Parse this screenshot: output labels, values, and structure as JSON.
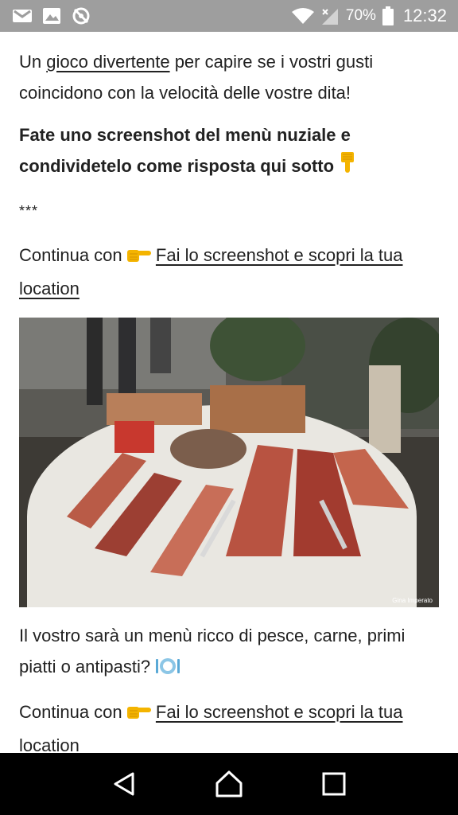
{
  "status_bar": {
    "battery_percent": "70%",
    "time": "12:32",
    "icons": [
      "gmail-icon",
      "image-icon",
      "settings-off-icon",
      "wifi-icon",
      "signal-icon",
      "battery-icon"
    ]
  },
  "article": {
    "p1_before": "Un ",
    "p1_link": "gioco divertente",
    "p1_after": " per capire se i vostri gusti coincidono con la velocità delle vostre dita!",
    "p2_text": "Fate uno screenshot del menù nuziale e condividetelo come risposta qui sotto",
    "stars": "***",
    "p3_before": "Continua con",
    "p3_link": "Fai lo screenshot e scopri la tua location",
    "photo_credit": "Gina Imperato",
    "p4_text": "Il vostro sarà un menù ricco di pesce, carne, primi piatti o antipasti?",
    "p5_before": "Continua con",
    "p5_link": "Fai lo screenshot e scopri la tua location"
  },
  "nav_bar": {
    "buttons": [
      "back-icon",
      "home-icon",
      "recents-icon"
    ]
  },
  "colors": {
    "status_bar": "#9e9e9e",
    "nav_bar": "#000000",
    "text": "#222222",
    "emoji_yellow": "#f4b400",
    "emoji_blue": "#5aa9d6"
  }
}
